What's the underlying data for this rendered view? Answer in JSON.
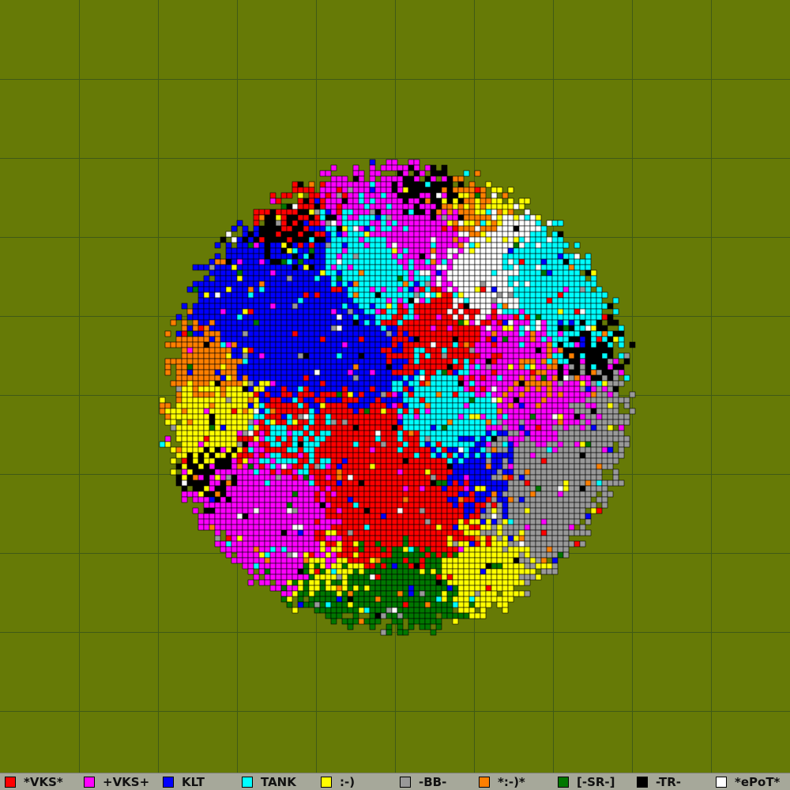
{
  "map": {
    "background_color": "#667a06",
    "grid_color": "#3f5a16",
    "grid_divisions": 10,
    "territory_shape": "circle"
  },
  "legend": {
    "items": [
      {
        "label": "*VKS*",
        "color": "#ff0000"
      },
      {
        "label": "+VKS+",
        "color": "#ff00ff"
      },
      {
        "label": "KLT",
        "color": "#0000ff"
      },
      {
        "label": "TANK",
        "color": "#00ffff"
      },
      {
        "label": ":-)",
        "color": "#ffff00"
      },
      {
        "label": "-BB-",
        "color": "#999999"
      },
      {
        "label": "*:-)*",
        "color": "#ff7f00"
      },
      {
        "label": "[-SR-]",
        "color": "#007700"
      },
      {
        "label": "-TR-",
        "color": "#000000"
      },
      {
        "label": "*ePoT*",
        "color": "#ffffff"
      }
    ]
  }
}
